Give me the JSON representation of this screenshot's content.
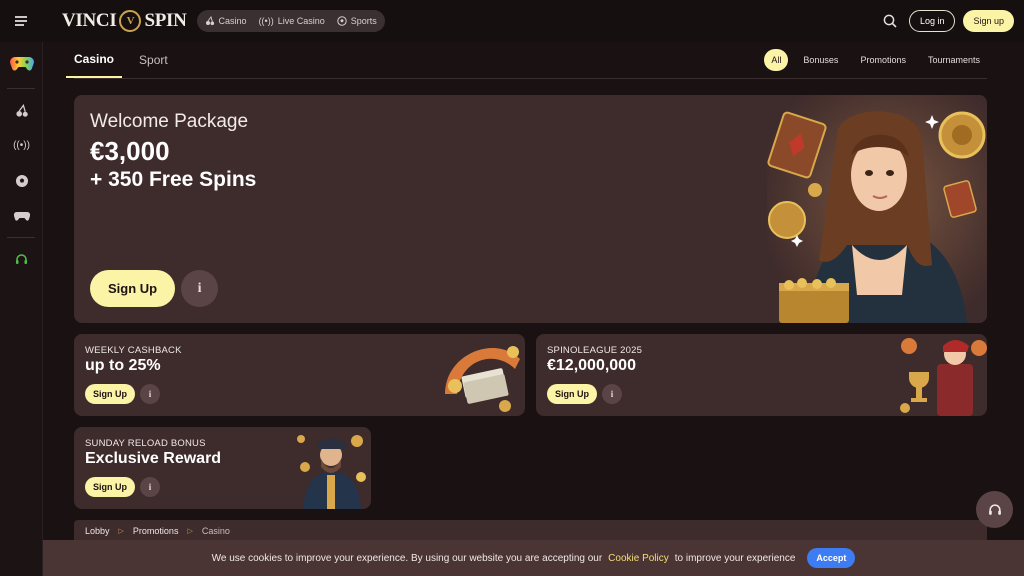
{
  "header": {
    "logo_left": "VINCI",
    "logo_right": "SPIN",
    "nav": [
      {
        "label": "Casino",
        "icon": "cherries-icon"
      },
      {
        "label": "Live Casino",
        "icon": "broadcast-icon"
      },
      {
        "label": "Sports",
        "icon": "soccer-ball-icon"
      }
    ],
    "login_label": "Log in",
    "signup_label": "Sign up"
  },
  "sidebar": {
    "items": [
      {
        "icon": "gamepad-rainbow-icon"
      },
      {
        "icon": "cherries-icon"
      },
      {
        "icon": "broadcast-icon"
      },
      {
        "icon": "soccer-ball-icon"
      },
      {
        "icon": "gamepad-icon"
      },
      {
        "icon": "headset-icon"
      }
    ]
  },
  "tabs": {
    "items": [
      "Casino",
      "Sport"
    ],
    "active": "Casino"
  },
  "filters": {
    "items": [
      "All",
      "Bonuses",
      "Promotions",
      "Tournaments"
    ],
    "active": "All"
  },
  "hero": {
    "title": "Welcome Package",
    "amount": "€3,000",
    "subtitle": "+ 350 Free Spins",
    "button_label": "Sign Up"
  },
  "promos": [
    {
      "label": "WEEKLY CASHBACK",
      "headline": "up to 25%",
      "button_label": "Sign Up"
    },
    {
      "label": "SPINOLEAGUE 2025",
      "headline": "€12,000,000",
      "button_label": "Sign Up"
    },
    {
      "label": "SUNDAY RELOAD BONUS",
      "headline": "Exclusive Reward",
      "button_label": "Sign Up"
    }
  ],
  "breadcrumb": [
    "Lobby",
    "Promotions",
    "Casino"
  ],
  "cookie": {
    "text_before": "We use cookies to improve your experience. By using our website you are accepting our",
    "link": "Cookie Policy",
    "text_after": "to improve your experience",
    "accept_label": "Accept"
  },
  "colors": {
    "accent_yellow": "#fbf3a6",
    "card_bg": "#3e2b2b",
    "page_bg": "#1a1212",
    "accept_blue": "#3d7cf2",
    "cookie_link": "#f4de7a"
  }
}
